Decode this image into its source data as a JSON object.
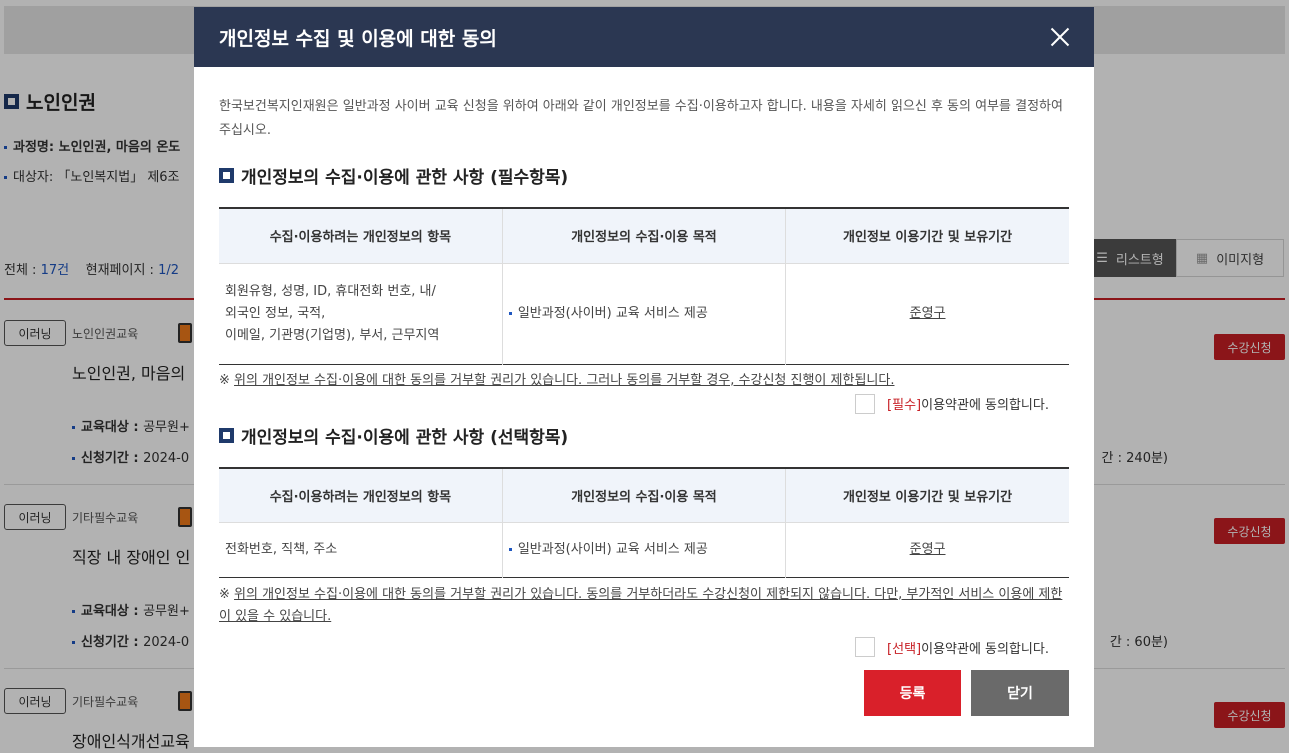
{
  "background": {
    "heading": "노인인권",
    "course_name_label": "과정명: 노인인권, 마음의 온도",
    "target_label": "대상자: 「노인복지법」 제6조",
    "total_label": "전체 : ",
    "total_count": "17건",
    "page_label": "현재페이지 : ",
    "page_value": "1/2",
    "view_list": "리스트형",
    "view_image": "이미지형",
    "courses": [
      {
        "type": "이러닝",
        "category": "노인인권교육",
        "title": "노인인권, 마음의",
        "apply": "수강신청",
        "target_label": "교육대상 : ",
        "target": "공무원+",
        "period_label": "신청기간 : ",
        "period": "2024-0",
        "time": "간 : 240분)"
      },
      {
        "type": "이러닝",
        "category": "기타필수교육",
        "title": "직장 내 장애인 인",
        "apply": "수강신청",
        "target_label": "교육대상 : ",
        "target": "공무원+",
        "period_label": "신청기간 : ",
        "period": "2024-0",
        "time": "간 : 60분)"
      },
      {
        "type": "이러닝",
        "category": "기타필수교육",
        "title": "장애인식개선교육",
        "apply": "수강신청"
      }
    ]
  },
  "modal": {
    "title": "개인정보 수집 및 이용에 대한 동의",
    "intro": "한국보건복지인재원은 일반과정 사이버 교육 신청을 위하여 아래와 같이 개인정보를 수집·이용하고자 합니다. 내용을 자세히 읽으신 후 동의 여부를 결정하여 주십시오.",
    "required": {
      "title": "개인정보의 수집·이용에 관한 사항 (필수항목)",
      "headers": [
        "수집·이용하려는 개인정보의 항목",
        "개인정보의 수집·이용 목적",
        "개인정보 이용기간 및 보유기간"
      ],
      "items_line1": "회원유형, 성명, ID, 휴대전화 번호, 내/",
      "items_line2": "외국인 정보, 국적,",
      "items_line3": "이메일, 기관명(기업명), 부서, 근무지역",
      "purpose": "일반과정(사이버) 교육 서비스 제공",
      "period": "준영구",
      "notice_mark": "※ ",
      "notice": "위의 개인정보 수집·이용에 대한 동의를 거부할 권리가 있습니다. 그러나 동의를 거부할 경우, 수강신청 진행이 제한됩니다.",
      "agree_tag": "[필수]",
      "agree_text": "이용약관에 동의합니다."
    },
    "optional": {
      "title": "개인정보의 수집·이용에 관한 사항 (선택항목)",
      "headers": [
        "수집·이용하려는 개인정보의 항목",
        "개인정보의 수집·이용 목적",
        "개인정보 이용기간 및 보유기간"
      ],
      "items": "전화번호, 직책, 주소",
      "purpose": "일반과정(사이버) 교육 서비스 제공",
      "period": "준영구",
      "notice_mark": "※ ",
      "notice": "위의 개인정보 수집·이용에 대한 동의를 거부할 권리가 있습니다. 동의를 거부하더라도 수강신청이 제한되지 않습니다. 다만, 부가적인 서비스 이용에 제한이 있을 수 있습니다.",
      "agree_tag": "[선택]",
      "agree_text": "이용약관에 동의합니다."
    },
    "submit_label": "등록",
    "close_label": "닫기"
  },
  "colors": {
    "header_bg": "#2b3752",
    "accent_red": "#d9202a",
    "close_btn": "#6a6a6a"
  },
  "icons": [
    "close-icon",
    "section-square-icon",
    "mobile-icon",
    "list-icon",
    "grid-icon"
  ]
}
